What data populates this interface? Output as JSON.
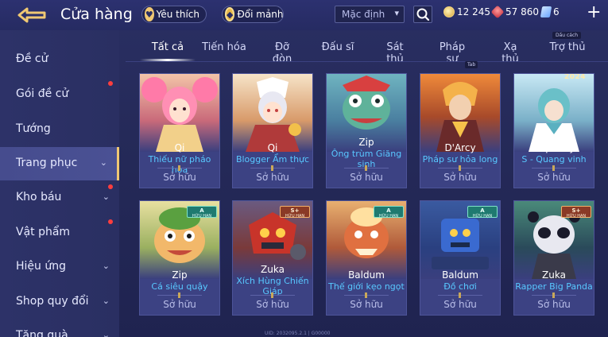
{
  "header": {
    "title": "Cửa hàng",
    "favorite_label": "Yêu thích",
    "fragments_label": "Đổi mảnh",
    "sort_value": "Mặc định",
    "gold": "12 245",
    "ruby": "57 860",
    "tickets": "6",
    "space_hint": "Dấu cách",
    "tab_hint": "Tab"
  },
  "sidebar": {
    "items": [
      {
        "label": "Đề cử",
        "dot": false,
        "chevron": false
      },
      {
        "label": "Gói đề cử",
        "dot": true,
        "chevron": false
      },
      {
        "label": "Tướng",
        "dot": false,
        "chevron": false
      },
      {
        "label": "Trang phục",
        "dot": false,
        "chevron": true,
        "active": true
      },
      {
        "label": "Kho báu",
        "dot": true,
        "chevron": true
      },
      {
        "label": "Vật phẩm",
        "dot": true,
        "chevron": false
      },
      {
        "label": "Hiệu ứng",
        "dot": false,
        "chevron": true
      },
      {
        "label": "Shop quy đổi",
        "dot": false,
        "chevron": true
      },
      {
        "label": "Tặng quà",
        "dot": false,
        "chevron": true
      }
    ]
  },
  "tabs": [
    {
      "label": "Tất cả",
      "active": true
    },
    {
      "label": "Tiến hóa"
    },
    {
      "label": "Đỡ đòn"
    },
    {
      "label": "Đấu sĩ"
    },
    {
      "label": "Sát thủ"
    },
    {
      "label": "Pháp sư"
    },
    {
      "label": "Xạ thủ"
    },
    {
      "label": "Trợ thủ"
    }
  ],
  "cards": [
    {
      "hero": "Qi",
      "skin": "Thiếu nữ pháo hoa",
      "status": "Sở hữu"
    },
    {
      "hero": "Qi",
      "skin": "Blogger Ẩm thực",
      "status": "Sở hữu"
    },
    {
      "hero": "Zip",
      "skin": "Ông trùm Giăng sinh",
      "status": "Sở hữu"
    },
    {
      "hero": "D'Arcy",
      "skin": "Pháp sư hỏa long",
      "status": "Sở hữu"
    },
    {
      "hero": "Capheny",
      "skin": "S - Quang vinh",
      "status": "Sở hữu",
      "year": "2024"
    },
    {
      "hero": "Zip",
      "skin": "Cá siêu quậy",
      "status": "Sở hữu",
      "badge": "A",
      "badge_text": "HỮU HẠN"
    },
    {
      "hero": "Zuka",
      "skin": "Xích Hùng Chiến Giáp",
      "status": "Sở hữu",
      "badge": "S+",
      "badge_text": "HỮU HẠN"
    },
    {
      "hero": "Baldum",
      "skin": "Thế giới kẹo ngọt",
      "status": "Sở hữu",
      "badge": "A",
      "badge_text": "HỮU HẠN"
    },
    {
      "hero": "Baldum",
      "skin": "Đồ chơi",
      "status": "Sở hữu",
      "badge": "A",
      "badge_text": "HỮU HẠN"
    },
    {
      "hero": "Zuka",
      "skin": "Rapper Big Panda",
      "status": "Sở hữu",
      "badge": "S+",
      "badge_text": "HỮU HẠN"
    }
  ],
  "footer_text": "UID: 2032095.2.1 | G00000",
  "colors": {
    "accent_gold": "#f0c873",
    "skin_name_blue": "#58c8ff",
    "notification_red": "#ff3e3e"
  }
}
